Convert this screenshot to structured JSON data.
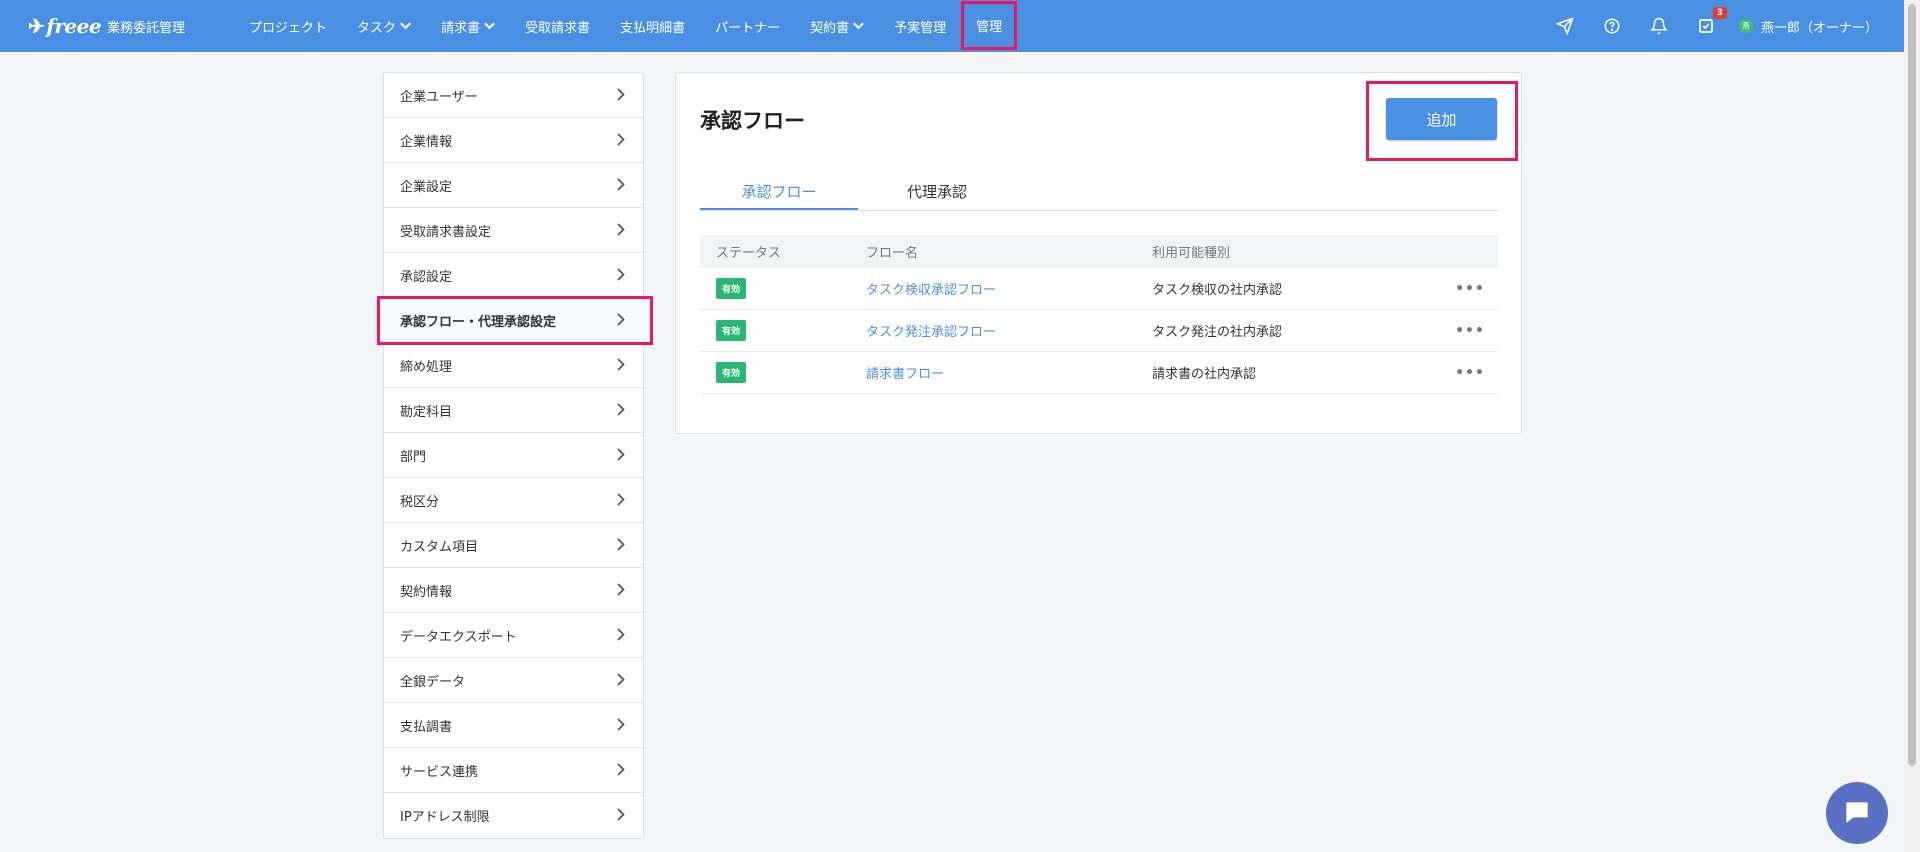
{
  "brand": {
    "logo": "freee",
    "name": "業務委託管理"
  },
  "nav": {
    "items": [
      {
        "label": "プロジェクト",
        "dropdown": false
      },
      {
        "label": "タスク",
        "dropdown": true
      },
      {
        "label": "請求書",
        "dropdown": true
      },
      {
        "label": "受取請求書",
        "dropdown": false
      },
      {
        "label": "支払明細書",
        "dropdown": false
      },
      {
        "label": "パートナー",
        "dropdown": false
      },
      {
        "label": "契約書",
        "dropdown": true
      },
      {
        "label": "予実管理",
        "dropdown": false
      },
      {
        "label": "管理",
        "dropdown": false,
        "active": true
      }
    ],
    "right": {
      "icons": [
        "send-icon",
        "help-icon",
        "bell-icon",
        "task-check-icon"
      ],
      "task_badge": "3",
      "user_avatar": "燕",
      "user_name": "燕一郎（オーナー）"
    }
  },
  "sidebar": {
    "items": [
      {
        "label": "企業ユーザー"
      },
      {
        "label": "企業情報"
      },
      {
        "label": "企業設定"
      },
      {
        "label": "受取請求書設定"
      },
      {
        "label": "承認設定"
      },
      {
        "label": "承認フロー・代理承認設定",
        "active": true
      },
      {
        "label": "締め処理"
      },
      {
        "label": "勘定科目"
      },
      {
        "label": "部門"
      },
      {
        "label": "税区分"
      },
      {
        "label": "カスタム項目"
      },
      {
        "label": "契約情報"
      },
      {
        "label": "データエクスポート"
      },
      {
        "label": "全銀データ"
      },
      {
        "label": "支払調書"
      },
      {
        "label": "サービス連携"
      },
      {
        "label": "IPアドレス制限"
      }
    ]
  },
  "main": {
    "title": "承認フロー",
    "add_button": "追加",
    "tabs": [
      {
        "label": "承認フロー",
        "active": true
      },
      {
        "label": "代理承認",
        "active": false
      }
    ],
    "table": {
      "headers": [
        "ステータス",
        "フロー名",
        "利用可能種別"
      ],
      "rows": [
        {
          "status": "有効",
          "name": "タスク検収承認フロー",
          "type": "タスク検収の社内承認"
        },
        {
          "status": "有効",
          "name": "タスク発注承認フロー",
          "type": "タスク発注の社内承認"
        },
        {
          "status": "有効",
          "name": "請求書フロー",
          "type": "請求書の社内承認"
        }
      ],
      "more_label": "•••"
    }
  },
  "colors": {
    "header": "#4a90e2",
    "highlight": "#e8195e",
    "status_active": "#2bb673",
    "chat": "#5b70c4"
  }
}
